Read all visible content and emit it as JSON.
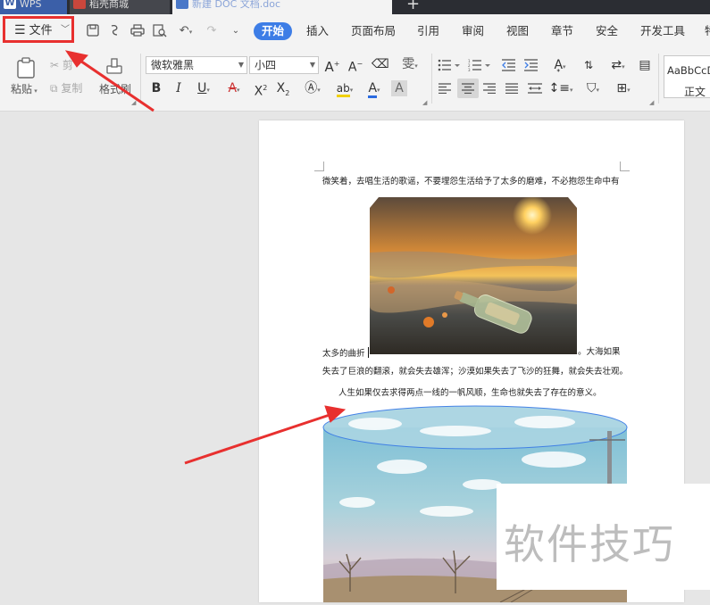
{
  "tabs": {
    "app": "WPS",
    "store": "稻壳商城",
    "document": "新建 DOC 文档.doc",
    "add": "+"
  },
  "menu": {
    "file": "文件",
    "items": [
      "开始",
      "插入",
      "页面布局",
      "引用",
      "审阅",
      "视图",
      "章节",
      "安全",
      "开发工具",
      "特"
    ]
  },
  "ribbon": {
    "paste": "粘贴",
    "cut": "剪",
    "copy": "复制",
    "format_painter": "格式刷",
    "font_name": "微软雅黑",
    "font_size": "小四",
    "style_sample": "AaBbCcDd",
    "style_name": "正文"
  },
  "document": {
    "line1": "微笑着，去唱生活的歌谣，不要埋怨生活给予了太多的磨难，不必抱怨生命中有",
    "line2_start": "太多的曲折",
    "line2_end": "。大海如果",
    "line3": "失去了巨浪的翻滚，就会失去雄浑；沙漠如果失去了飞沙的狂舞，就会失去壮观。",
    "line4": "人生如果仅去求得两点一线的一帆风顺，生命也就失去了存在的意义。"
  },
  "watermark": "软件技巧",
  "colors": {
    "accent": "#3d7de6",
    "annotation_red": "#e8302f",
    "tab_wps": "#3b5fa8"
  }
}
